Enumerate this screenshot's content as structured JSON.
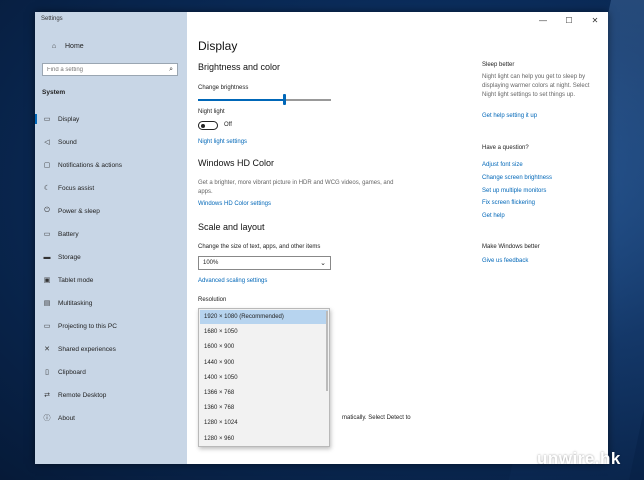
{
  "window": {
    "title": "Settings",
    "minimize": "—",
    "maximize": "☐",
    "close": "✕"
  },
  "sidebar": {
    "home": "Home",
    "search_placeholder": "Find a setting",
    "section": "System",
    "items": [
      {
        "label": "Display",
        "icon": "display-icon",
        "glyph": "▭"
      },
      {
        "label": "Sound",
        "icon": "speaker-icon",
        "glyph": "◁"
      },
      {
        "label": "Notifications & actions",
        "icon": "notifications-icon",
        "glyph": "▢"
      },
      {
        "label": "Focus assist",
        "icon": "moon-icon",
        "glyph": "☾"
      },
      {
        "label": "Power & sleep",
        "icon": "power-icon",
        "glyph": "⏻"
      },
      {
        "label": "Battery",
        "icon": "battery-icon",
        "glyph": "▭"
      },
      {
        "label": "Storage",
        "icon": "storage-icon",
        "glyph": "▬"
      },
      {
        "label": "Tablet mode",
        "icon": "tablet-icon",
        "glyph": "▣"
      },
      {
        "label": "Multitasking",
        "icon": "multitasking-icon",
        "glyph": "▤"
      },
      {
        "label": "Projecting to this PC",
        "icon": "projecting-icon",
        "glyph": "▭"
      },
      {
        "label": "Shared experiences",
        "icon": "shared-experiences-icon",
        "glyph": "✕"
      },
      {
        "label": "Clipboard",
        "icon": "clipboard-icon",
        "glyph": "▯"
      },
      {
        "label": "Remote Desktop",
        "icon": "remote-desktop-icon",
        "glyph": "⇄"
      },
      {
        "label": "About",
        "icon": "info-icon",
        "glyph": "ⓘ"
      }
    ]
  },
  "main": {
    "title": "Display",
    "brightness_heading": "Brightness and color",
    "change_brightness": "Change brightness",
    "brightness_level": 0.65,
    "night_light": "Night light",
    "night_light_state": "Off",
    "night_light_settings": "Night light settings",
    "hd_heading": "Windows HD Color",
    "hd_desc": "Get a brighter, more vibrant picture in HDR and WCG videos, games, and apps.",
    "hd_settings": "Windows HD Color settings",
    "scale_heading": "Scale and layout",
    "scale_label": "Change the size of text, apps, and other items",
    "scale_value": "100%",
    "advanced_scaling": "Advanced scaling settings",
    "resolution_label": "Resolution",
    "resolutions": [
      "1920 × 1080 (Recommended)",
      "1680 × 1050",
      "1600 × 900",
      "1440 × 900",
      "1400 × 1050",
      "1366 × 768",
      "1360 × 768",
      "1280 × 1024",
      "1280 × 960"
    ],
    "partial_text": "matically. Select Detect to"
  },
  "right": {
    "sleep_heading": "Sleep better",
    "sleep_text": "Night light can help you get to sleep by displaying warmer colors at night. Select Night light settings to set things up.",
    "sleep_link": "Get help setting it up",
    "question_heading": "Have a question?",
    "question_links": [
      "Adjust font size",
      "Change screen brightness",
      "Set up multiple monitors",
      "Fix screen flickering",
      "Get help"
    ],
    "better_heading": "Make Windows better",
    "feedback_link": "Give us feedback"
  },
  "watermark": "unwire.hk"
}
